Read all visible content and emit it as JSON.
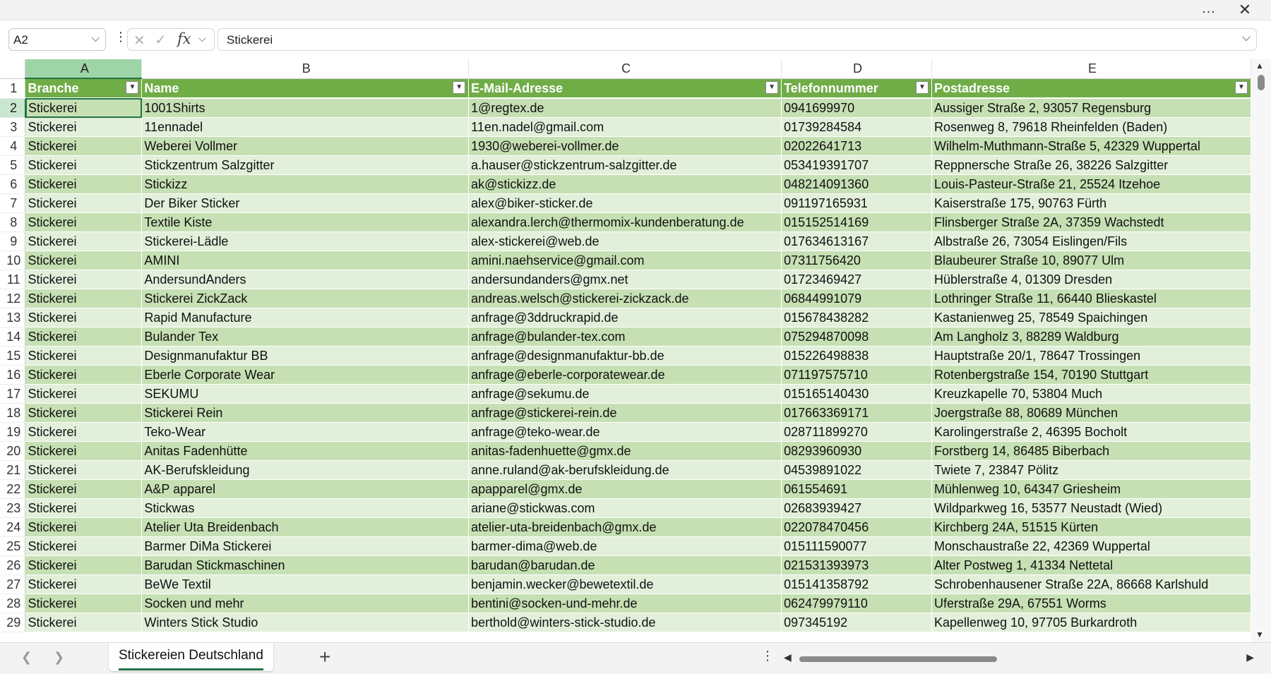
{
  "topbar": {
    "more_icon": "…",
    "close_icon": "✕"
  },
  "formula_bar": {
    "name_box": "A2",
    "cancel_icon": "✕",
    "confirm_icon": "✓",
    "fx_label": "fx",
    "formula_value": "Stickerei"
  },
  "columns": [
    "A",
    "B",
    "C",
    "D",
    "E"
  ],
  "headers": [
    "Branche",
    "Name",
    "E-Mail-Adresse",
    "Telefonnummer",
    "Postadresse"
  ],
  "rows": [
    {
      "n": "2",
      "cells": [
        "Stickerei",
        "1001Shirts",
        "1@regtex.de",
        "0941699970",
        "Aussiger Straße 2, 93057 Regensburg"
      ]
    },
    {
      "n": "3",
      "cells": [
        "Stickerei",
        "11ennadel",
        "11en.nadel@gmail.com",
        "01739284584",
        "Rosenweg 8, 79618 Rheinfelden (Baden)"
      ]
    },
    {
      "n": "4",
      "cells": [
        "Stickerei",
        "Weberei Vollmer",
        "1930@weberei-vollmer.de",
        "02022641713",
        "Wilhelm-Muthmann-Straße 5, 42329 Wuppertal"
      ]
    },
    {
      "n": "5",
      "cells": [
        "Stickerei",
        "Stickzentrum Salzgitter",
        "a.hauser@stickzentrum-salzgitter.de",
        "053419391707",
        "Reppnersche Straße 26, 38226 Salzgitter"
      ]
    },
    {
      "n": "6",
      "cells": [
        "Stickerei",
        "Stickizz",
        "ak@stickizz.de",
        "048214091360",
        "Louis-Pasteur-Straße 21, 25524 Itzehoe"
      ]
    },
    {
      "n": "7",
      "cells": [
        "Stickerei",
        "Der Biker Sticker",
        "alex@biker-sticker.de",
        "091197165931",
        "Kaiserstraße 175, 90763 Fürth"
      ]
    },
    {
      "n": "8",
      "cells": [
        "Stickerei",
        "Textile Kiste",
        "alexandra.lerch@thermomix-kundenberatung.de",
        "015152514169",
        "Flinsberger Straße 2A, 37359 Wachstedt"
      ]
    },
    {
      "n": "9",
      "cells": [
        "Stickerei",
        "Stickerei-Lädle",
        "alex-stickerei@web.de",
        "017634613167",
        "Albstraße 26, 73054 Eislingen/Fils"
      ]
    },
    {
      "n": "10",
      "cells": [
        "Stickerei",
        "AMINI",
        "amini.naehservice@gmail.com",
        "07311756420",
        "Blaubeurer Straße 10, 89077 Ulm"
      ]
    },
    {
      "n": "11",
      "cells": [
        "Stickerei",
        "AndersundAnders",
        "andersundanders@gmx.net",
        "01723469427",
        "Hüblerstraße 4, 01309 Dresden"
      ]
    },
    {
      "n": "12",
      "cells": [
        "Stickerei",
        "Stickerei ZickZack",
        "andreas.welsch@stickerei-zickzack.de",
        "06844991079",
        "Lothringer Straße 11, 66440 Blieskastel"
      ]
    },
    {
      "n": "13",
      "cells": [
        "Stickerei",
        "Rapid Manufacture",
        "anfrage@3ddruckrapid.de",
        "015678438282",
        "Kastanienweg 25, 78549 Spaichingen"
      ]
    },
    {
      "n": "14",
      "cells": [
        "Stickerei",
        "Bulander Tex",
        "anfrage@bulander-tex.com",
        "075294870098",
        "Am Langholz 3, 88289 Waldburg"
      ]
    },
    {
      "n": "15",
      "cells": [
        "Stickerei",
        "Designmanufaktur BB",
        "anfrage@designmanufaktur-bb.de",
        "015226498838",
        "Hauptstraße 20/1, 78647 Trossingen"
      ]
    },
    {
      "n": "16",
      "cells": [
        "Stickerei",
        "Eberle Corporate Wear",
        "anfrage@eberle-corporatewear.de",
        "071197575710",
        "Rotenbergstraße 154, 70190 Stuttgart"
      ]
    },
    {
      "n": "17",
      "cells": [
        "Stickerei",
        "SEKUMU",
        "anfrage@sekumu.de",
        "015165140430",
        "Kreuzkapelle 70, 53804 Much"
      ]
    },
    {
      "n": "18",
      "cells": [
        "Stickerei",
        "Stickerei Rein",
        "anfrage@stickerei-rein.de",
        "017663369171",
        "Joergstraße 88, 80689 München"
      ]
    },
    {
      "n": "19",
      "cells": [
        "Stickerei",
        "Teko-Wear",
        "anfrage@teko-wear.de",
        "028711899270",
        "Karolingerstraße 2, 46395 Bocholt"
      ]
    },
    {
      "n": "20",
      "cells": [
        "Stickerei",
        "Anitas Fadenhütte",
        "anitas-fadenhuette@gmx.de",
        "08293960930",
        "Forstberg 14, 86485 Biberbach"
      ]
    },
    {
      "n": "21",
      "cells": [
        "Stickerei",
        "AK-Berufskleidung",
        "anne.ruland@ak-berufskleidung.de",
        "04539891022",
        "Twiete 7, 23847 Pölitz"
      ]
    },
    {
      "n": "22",
      "cells": [
        "Stickerei",
        "A&P apparel",
        "apapparel@gmx.de",
        "061554691",
        "Mühlenweg 10, 64347 Griesheim"
      ]
    },
    {
      "n": "23",
      "cells": [
        "Stickerei",
        "Stickwas",
        "ariane@stickwas.com",
        "02683939427",
        "Wildparkweg 16, 53577 Neustadt (Wied)"
      ]
    },
    {
      "n": "24",
      "cells": [
        "Stickerei",
        "Atelier Uta Breidenbach",
        "atelier-uta-breidenbach@gmx.de",
        "022078470456",
        "Kirchberg 24A, 51515 Kürten"
      ]
    },
    {
      "n": "25",
      "cells": [
        "Stickerei",
        "Barmer DiMa Stickerei",
        "barmer-dima@web.de",
        "015111590077",
        "Monschaustraße 22, 42369 Wuppertal"
      ]
    },
    {
      "n": "26",
      "cells": [
        "Stickerei",
        "Barudan Stickmaschinen",
        "barudan@barudan.de",
        "021531393973",
        "Alter Postweg 1, 41334 Nettetal"
      ]
    },
    {
      "n": "27",
      "cells": [
        "Stickerei",
        "BeWe Textil",
        "benjamin.wecker@bewetextil.de",
        "015141358792",
        "Schrobenhausener Straße 22A, 86668 Karlshuld"
      ]
    },
    {
      "n": "28",
      "cells": [
        "Stickerei",
        "Socken und mehr",
        "bentini@socken-und-mehr.de",
        "062479979110",
        "Uferstraße 29A, 67551 Worms"
      ]
    },
    {
      "n": "29",
      "cells": [
        "Stickerei",
        "Winters Stick Studio",
        "berthold@winters-stick-studio.de",
        "097345192",
        "Kapellenweg 10, 97705 Burkardroth"
      ]
    }
  ],
  "sheet_tab": "Stickereien Deutschland",
  "add_sheet_icon": "+",
  "colors": {
    "header_green": "#70ad47",
    "band_dark": "#c6e0b4",
    "band_light": "#e2efda",
    "accent": "#217346"
  }
}
